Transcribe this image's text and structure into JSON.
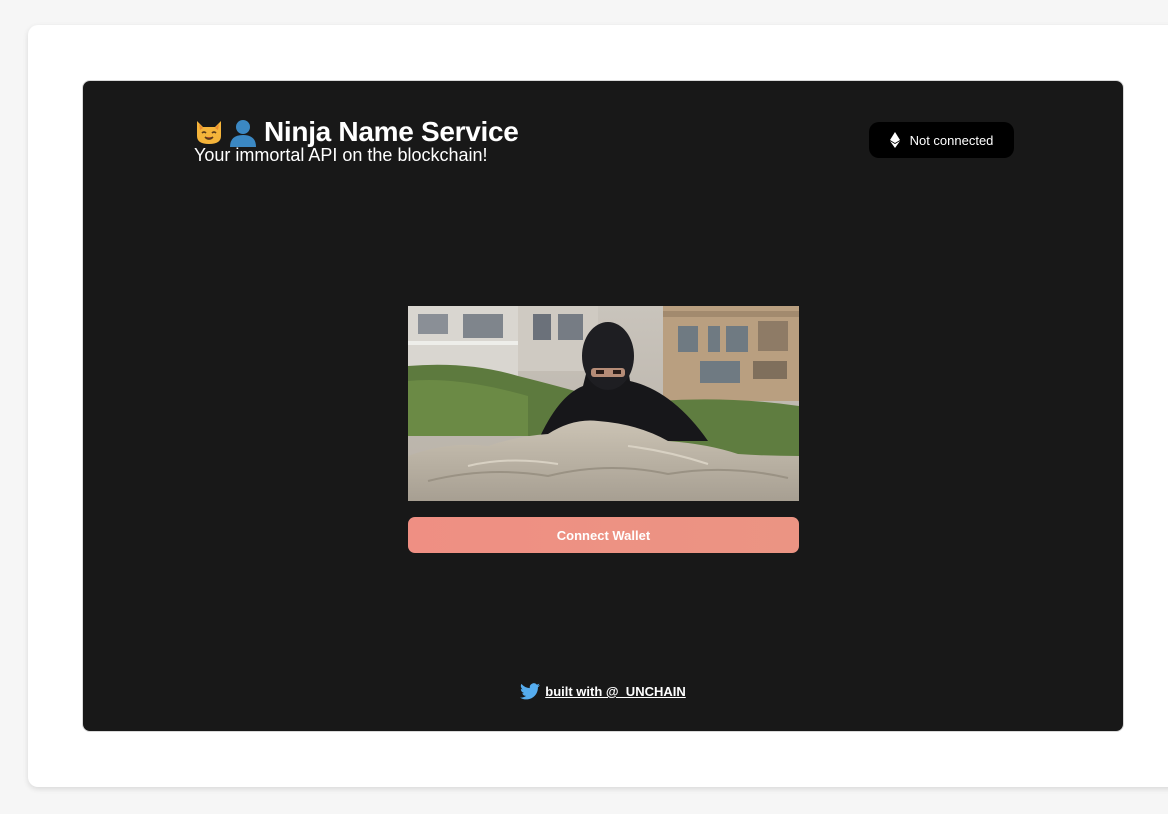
{
  "header": {
    "title": "Ninja Name Service",
    "subtitle": "Your immortal API on the blockchain!",
    "title_icons": [
      "cat-face-icon",
      "person-silhouette-icon"
    ]
  },
  "wallet_status": {
    "icon": "ethereum-icon",
    "label": "Not connected"
  },
  "hero": {
    "image": "ninja-in-sand-image"
  },
  "connect_button": {
    "label": "Connect Wallet"
  },
  "footer": {
    "icon": "twitter-bird-icon",
    "link_text": "built with @_UNCHAIN"
  },
  "colors": {
    "background": "#181818",
    "accent": "#ee8f83",
    "pill": "#000000",
    "twitter": "#55acee"
  }
}
